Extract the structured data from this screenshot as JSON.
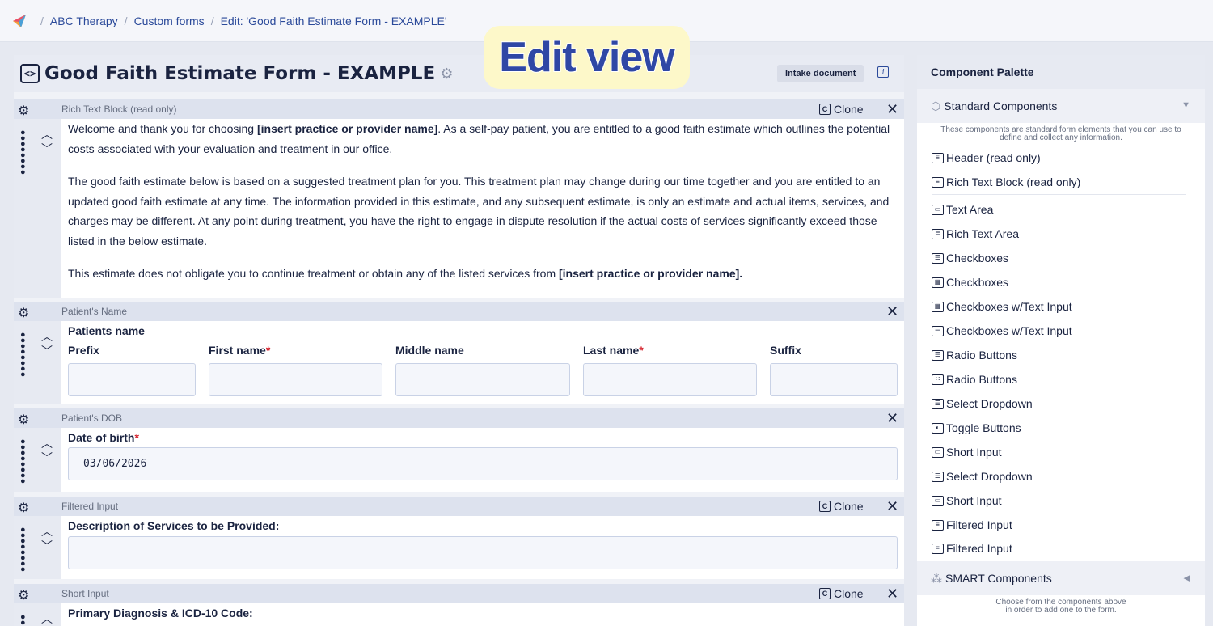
{
  "breadcrumb": [
    "ABC Therapy",
    "Custom forms",
    "Edit: 'Good Faith Estimate Form - EXAMPLE'"
  ],
  "badge": "Edit view",
  "form": {
    "title": "Good Faith Estimate Form - EXAMPLE",
    "intake_label": "Intake document",
    "info_label": "i"
  },
  "blocks": {
    "rich": {
      "type": "Rich Text Block (read only)",
      "clone": "Clone",
      "p1a": "Welcome and thank you for choosing ",
      "p1b": "[insert practice or provider name]",
      "p1c": ". As a self-pay patient, you are entitled to a good faith estimate which outlines the potential costs associated with your evaluation and treatment in our office.",
      "p2": "The good faith estimate below is based on a suggested treatment plan for you. This treatment plan may change during our time together and you are entitled to an updated good faith estimate at any time. The information provided in this estimate, and any subsequent estimate, is only an estimate and actual items, services, and charges may be different. At any point during treatment, you have the right to engage in dispute resolution if the actual costs of services significantly exceed those listed in the below estimate.",
      "p3a": "This estimate does not obligate you to continue treatment or obtain any of the listed services from  ",
      "p3b": "[insert practice or provider name]."
    },
    "name": {
      "type": "Patient's Name",
      "heading": "Patients name",
      "prefix": "Prefix",
      "first": "First name",
      "middle": "Middle name",
      "last": "Last name",
      "suffix": "Suffix",
      "required_mark": "*"
    },
    "dob": {
      "type": "Patient's DOB",
      "label": "Date of birth",
      "value": "03/06/2026"
    },
    "filtered": {
      "type": "Filtered Input",
      "clone": "Clone",
      "label": "Description of Services to be Provided:"
    },
    "short": {
      "type": "Short Input",
      "clone": "Clone",
      "label": "Primary Diagnosis & ICD-10 Code:"
    }
  },
  "palette": {
    "title": "Component Palette",
    "standard": "Standard Components",
    "standard_desc1": "These components are standard form elements that you can use to",
    "standard_desc2": "define and collect any information.",
    "items": [
      "Header (read only)",
      "Rich Text Block (read only)",
      "Text Area",
      "Rich Text Area",
      "Checkboxes",
      "Checkboxes",
      "Checkboxes w/Text Input",
      "Checkboxes w/Text Input",
      "Radio Buttons",
      "Radio Buttons",
      "Select Dropdown",
      "Toggle Buttons",
      "Short Input",
      "Select Dropdown",
      "Short Input",
      "Filtered Input",
      "Filtered Input"
    ],
    "smart": "SMART Components",
    "smart_desc1": "Choose from the components above",
    "smart_desc2": "in order to add one to the form."
  }
}
